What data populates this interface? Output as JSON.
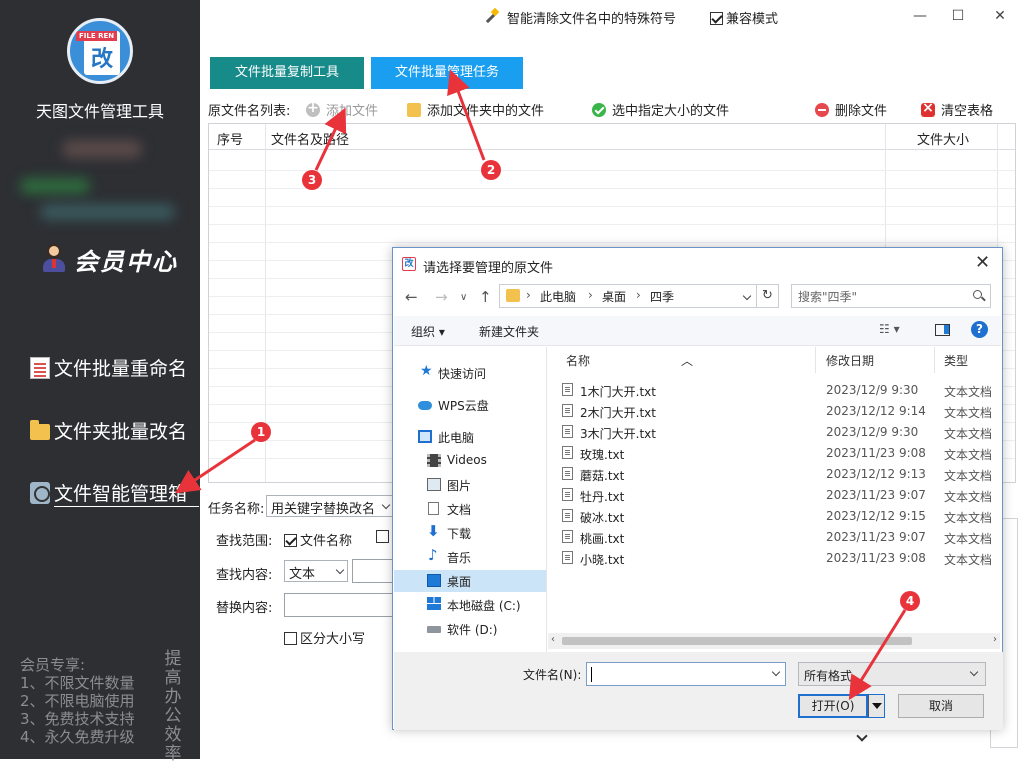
{
  "sidebar": {
    "logo_tag": "FILE REN",
    "logo_glyph": "改",
    "app_title": "天图文件管理工具",
    "member_center": "会员中心",
    "nav": [
      {
        "label": "文件批量重命名"
      },
      {
        "label": "文件夹批量改名"
      },
      {
        "label": "文件智能管理箱"
      }
    ],
    "vip_lines": [
      "会员专享:",
      "1、不限文件数量",
      "2、不限电脑使用",
      "3、免费技术支持",
      "4、永久免费升级"
    ],
    "slogan": "提高办公效率"
  },
  "header": {
    "feature_name": "智能清除文件名中的特殊符号",
    "compat_label": "兼容模式",
    "compat_checked": true,
    "minimize": "—",
    "maximize": "☐",
    "close": "✕"
  },
  "tabs": [
    {
      "label": "文件批量复制工具",
      "color": "#178a8a"
    },
    {
      "label": "文件批量管理任务",
      "color": "#1a9ff0"
    }
  ],
  "toolbar": {
    "list_label": "原文件名列表:",
    "add_file": "添加文件",
    "add_folder_files": "添加文件夹中的文件",
    "select_by_size": "选中指定大小的文件",
    "delete_file": "删除文件",
    "clear_table": "清空表格"
  },
  "table": {
    "columns": [
      "序号",
      "文件名及路径",
      "文件大小"
    ]
  },
  "task": {
    "task_name_label": "任务名称:",
    "task_name_value": "用关键字替换改名",
    "scope_label": "查找范围:",
    "scope_filename": "文件名称",
    "find_label": "查找内容:",
    "find_type": "文本",
    "replace_label": "替换内容:",
    "case_label": "区分大小写"
  },
  "dialog": {
    "title": "请选择要管理的原文件",
    "icon_glyph": "改",
    "close": "✕",
    "breadcrumb": [
      "此电脑",
      "桌面",
      "四季"
    ],
    "search_placeholder": "搜索\"四季\"",
    "organize": "组织 ▾",
    "new_folder": "新建文件夹",
    "nav": [
      {
        "label": "快速访问",
        "icon": "star-icon"
      },
      {
        "label": "WPS云盘",
        "icon": "cloud-icon"
      },
      {
        "label": "此电脑",
        "icon": "pc-icon"
      },
      {
        "label": "Videos",
        "icon": "video-icon"
      },
      {
        "label": "图片",
        "icon": "picture-icon"
      },
      {
        "label": "文档",
        "icon": "document-icon"
      },
      {
        "label": "下载",
        "icon": "download-icon"
      },
      {
        "label": "音乐",
        "icon": "music-icon"
      },
      {
        "label": "桌面",
        "icon": "desktop-icon",
        "selected": true
      },
      {
        "label": "本地磁盘 (C:)",
        "icon": "disk-c-icon"
      },
      {
        "label": "软件 (D:)",
        "icon": "disk-d-icon"
      }
    ],
    "columns": {
      "name": "名称",
      "date": "修改日期",
      "type": "类型"
    },
    "files": [
      {
        "name": "1木门大开.txt",
        "date": "2023/12/9 9:30",
        "type": "文本文档"
      },
      {
        "name": "2木门大开.txt",
        "date": "2023/12/12 9:14",
        "type": "文本文档"
      },
      {
        "name": "3木门大开.txt",
        "date": "2023/12/9 9:30",
        "type": "文本文档"
      },
      {
        "name": "玫瑰.txt",
        "date": "2023/11/23 9:08",
        "type": "文本文档"
      },
      {
        "name": "蘑菇.txt",
        "date": "2023/12/12 9:13",
        "type": "文本文档"
      },
      {
        "name": "牡丹.txt",
        "date": "2023/11/23 9:07",
        "type": "文本文档"
      },
      {
        "name": "破冰.txt",
        "date": "2023/12/12 9:15",
        "type": "文本文档"
      },
      {
        "name": "桃画.txt",
        "date": "2023/11/23 9:07",
        "type": "文本文档"
      },
      {
        "name": "小晓.txt",
        "date": "2023/11/23 9:08",
        "type": "文本文档"
      }
    ],
    "filename_label": "文件名(N):",
    "filename_value": "",
    "filetype": "所有格式",
    "open": "打开(O)",
    "cancel": "取消"
  },
  "annotations": [
    "1",
    "2",
    "3",
    "4"
  ]
}
